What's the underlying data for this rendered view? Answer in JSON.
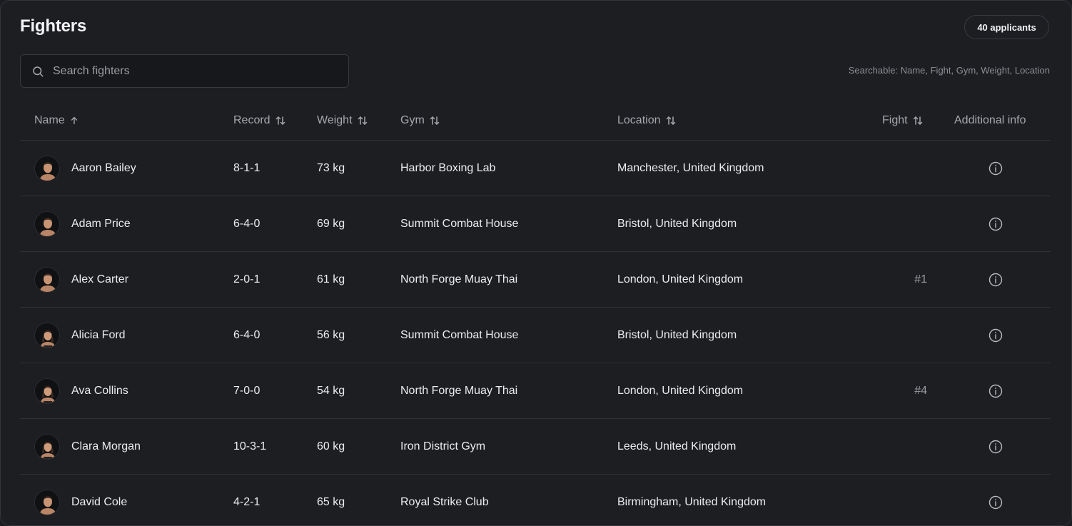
{
  "header": {
    "title": "Fighters",
    "applicants_badge": "40 applicants"
  },
  "search": {
    "placeholder": "Search fighters",
    "value": "",
    "hint": "Searchable: Name, Fight, Gym, Weight, Location"
  },
  "table": {
    "columns": [
      {
        "label": "Name",
        "sort": "asc"
      },
      {
        "label": "Record",
        "sort": "none"
      },
      {
        "label": "Weight",
        "sort": "none"
      },
      {
        "label": "Gym",
        "sort": "none"
      },
      {
        "label": "Location",
        "sort": "none"
      },
      {
        "label": "Fight",
        "sort": "none"
      },
      {
        "label": "Additional info",
        "sort": null
      }
    ],
    "rows": [
      {
        "name": "Aaron Bailey",
        "record": "8-1-1",
        "weight": "73 kg",
        "gym": "Harbor Boxing Lab",
        "location": "Manchester, United Kingdom",
        "fight": "",
        "avatar_gender": "male"
      },
      {
        "name": "Adam Price",
        "record": "6-4-0",
        "weight": "69 kg",
        "gym": "Summit Combat House",
        "location": "Bristol, United Kingdom",
        "fight": "",
        "avatar_gender": "male"
      },
      {
        "name": "Alex Carter",
        "record": "2-0-1",
        "weight": "61 kg",
        "gym": "North Forge Muay Thai",
        "location": "London, United Kingdom",
        "fight": "#1",
        "avatar_gender": "male"
      },
      {
        "name": "Alicia Ford",
        "record": "6-4-0",
        "weight": "56 kg",
        "gym": "Summit Combat House",
        "location": "Bristol, United Kingdom",
        "fight": "",
        "avatar_gender": "female"
      },
      {
        "name": "Ava Collins",
        "record": "7-0-0",
        "weight": "54 kg",
        "gym": "North Forge Muay Thai",
        "location": "London, United Kingdom",
        "fight": "#4",
        "avatar_gender": "female"
      },
      {
        "name": "Clara Morgan",
        "record": "10-3-1",
        "weight": "60 kg",
        "gym": "Iron District Gym",
        "location": "Leeds, United Kingdom",
        "fight": "",
        "avatar_gender": "female"
      },
      {
        "name": "David Cole",
        "record": "4-2-1",
        "weight": "65 kg",
        "gym": "Royal Strike Club",
        "location": "Birmingham, United Kingdom",
        "fight": "",
        "avatar_gender": "male"
      }
    ]
  },
  "icons": {
    "search": "search-icon",
    "sort_asc": "arrow-up-icon",
    "sort_none": "sort-arrows-icon",
    "info": "info-circle-icon"
  },
  "colors": {
    "background": "#1d1e22",
    "text": "#ececee",
    "muted": "#a6a7ad",
    "border": "#303137"
  }
}
